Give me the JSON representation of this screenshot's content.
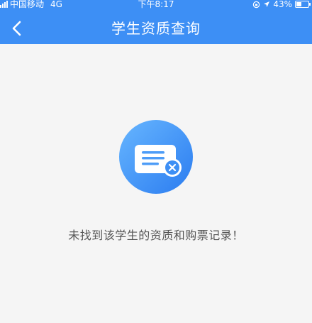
{
  "status_bar": {
    "carrier": "中国移动",
    "network": "4G",
    "time": "下午8:17",
    "battery": "43%",
    "battery_level": 0.43
  },
  "nav": {
    "title": "学生资质查询",
    "back_icon": "chevron-left-icon"
  },
  "empty_state": {
    "icon": "message-cancel-icon",
    "message": "未找到该学生的资质和购票记录！"
  },
  "colors": {
    "header": "#3d8ff5",
    "background": "#f5f5f5",
    "text": "#555555"
  }
}
